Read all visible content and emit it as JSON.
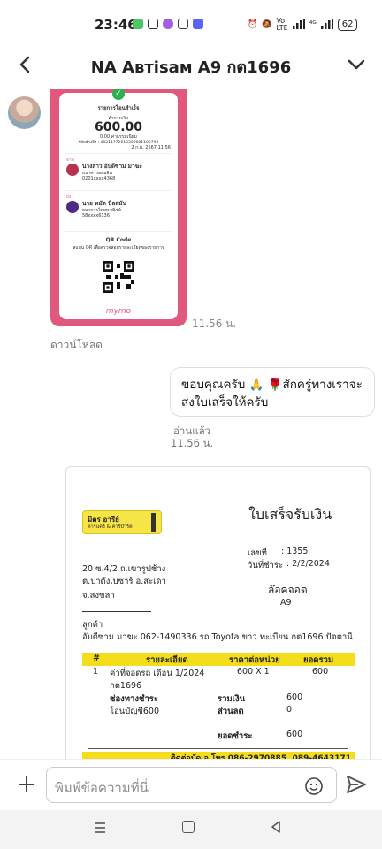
{
  "status_bar": {
    "time": "23:46",
    "battery": "62"
  },
  "header": {
    "title": "NA Автisам A9 กต1696"
  },
  "messages": {
    "incoming_time": "11.56 น.",
    "download_label": "ดาวน์โหลด",
    "outgoing_text": "ขอบคุณครับ 🙏 🌹สักครู่ทางเราจะส่งใบเสร็จให้ครับ",
    "read_label": "อ่านแล้ว",
    "outgoing_time": "11.56 น."
  },
  "receipt_image": {
    "title": "รายการโอนสำเร็จ",
    "amount_label": "จำนวนเงิน",
    "amount": "600.00",
    "fee": "0.00 ค่าธรรมเนียม",
    "ref": "รหัสอ้างอิง : 40211772010300001109790",
    "date": "2 ก.พ. 2567   11:56",
    "from_label": "จาก",
    "from_name": "นางสาว อับดีซาม มาฆะ",
    "from_bank": "ธนาคารออมสิน",
    "from_account": "0201xxxx4368",
    "to_label": "ถึง",
    "to_name": "นาย หมัด บิลสมัน",
    "to_bank": "ธนาคารไทยพาณิชย์",
    "to_account": "58xxxx6136",
    "qr_title": "QR Code",
    "qr_desc": "สแกน QR เพื่อตรวจสอบรายละเอียดของรายการ",
    "brand": "mymo"
  },
  "invoice": {
    "logo_name": "มิตร อารีย์",
    "logo_sub": "คาร์แคร์ & คาร์บ๊าร์ค",
    "title": "ใบเสร็จรับเงิน",
    "no_label": "เลขที่",
    "no_value": ": 1355",
    "date_label": "วันที่ชำระ",
    "date_value": ": 2/2/2024",
    "addr1": "20 ซ.4/2 ถ.เขารูปช้าง",
    "addr2": "ต.ปาดังเบซาร์ อ.สะเดา",
    "addr3": "จ.สงขลา",
    "lock_label": "ล๊อคจอด",
    "lock_value": "A9",
    "customer_label": "ลูกค้า",
    "customer_value": "อับดีซาม มาฆะ 062-1490336 รถ Toyota ขาว ทะเบียน กต1696 ปัตตานี",
    "col_no": "#",
    "col_desc": "รายละเอียด",
    "col_price": "ราคาต่อหน่วย",
    "col_total": "ยอดรวม",
    "row_no": "1",
    "row_desc1": "ค่าที่จอดรถ เดือน 1/2024",
    "row_desc2": "กต1696",
    "row_price": "600 X 1",
    "row_total": "600",
    "pay_label": "ช่องทางชำระ",
    "pay_value": "โอนบัญชี600",
    "sum_label": "รวมเงิน",
    "sum_value": "600",
    "discount_label": "ส่วนลด",
    "discount_value": "0",
    "paid_label": "ยอดชำระ",
    "paid_value": "600",
    "footer": "ติดต่อบัดเอ โทร 086-2970885, 089-4643171"
  },
  "input": {
    "placeholder": "พิมพ์ข้อความที่นี่"
  }
}
